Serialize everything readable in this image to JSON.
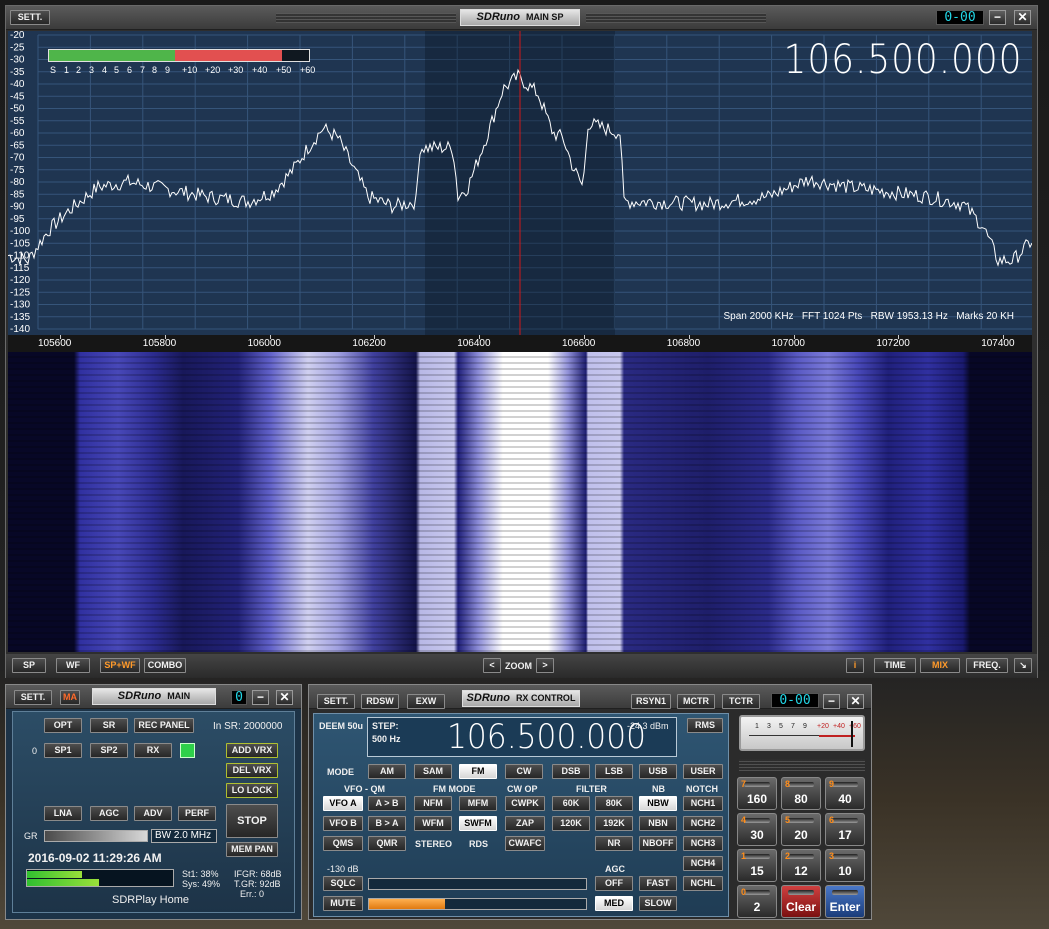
{
  "main_sp": {
    "sett_label": "SETT.",
    "logo_brand": "SDRuno",
    "logo_title": "MAIN SP",
    "led_counter": "0-00",
    "min_icon": "minimize-icon",
    "close_icon": "close-icon",
    "frequency": "106.500.000",
    "db_scale": [
      "-20",
      "-25",
      "-30",
      "-35",
      "-40",
      "-45",
      "-50",
      "-55",
      "-60",
      "-65",
      "-70",
      "-75",
      "-80",
      "-85",
      "-90",
      "-95",
      "-100",
      "-105",
      "-110",
      "-115",
      "-120",
      "-125",
      "-130",
      "-135",
      "-140"
    ],
    "smeter_scale": [
      "S",
      "1",
      "2",
      "3",
      "4",
      "5",
      "6",
      "7",
      "8",
      "9",
      "+10",
      "+20",
      "+30",
      "+40",
      "+50",
      "+60"
    ],
    "freq_axis": [
      "105600",
      "105800",
      "106000",
      "106200",
      "106400",
      "106600",
      "106800",
      "107000",
      "107200",
      "107400"
    ],
    "info_text": "Span 2000 KHz   FFT 1024 Pts   RBW 1953.13 Hz   Marks 20 KH",
    "bottom": {
      "sp": "SP",
      "wf": "WF",
      "spwf": "SP+WF",
      "combo": "COMBO",
      "zoom_left": "<",
      "zoom": "ZOOM",
      "zoom_right": ">",
      "info": "i",
      "time": "TIME",
      "mix": "MIX",
      "freq": "FREQ.",
      "resize_icon": "resize-icon"
    },
    "colors": {
      "grid_bg": "#1f3551",
      "trace": "#ffffff",
      "marker": "#d01818",
      "wf_mid": "#3a3aa8",
      "smeter_green": "#4fb54a",
      "smeter_red": "#e25050"
    }
  },
  "main": {
    "sett_label": "SETT.",
    "ma_label": "MA",
    "logo_brand": "SDRuno",
    "logo_title": "MAIN",
    "led_counter": "0",
    "buttons": {
      "opt": "OPT",
      "sr": "SR",
      "rec_panel": "REC PANEL",
      "sp1": "SP1",
      "sp2": "SP2",
      "rx": "RX",
      "add_vrx": "ADD VRX",
      "del_vrx": "DEL VRX",
      "lo_lock": "LO LOCK",
      "lna": "LNA",
      "agc": "AGC",
      "adv": "ADV",
      "perf": "PERF",
      "stop": "STOP",
      "mem_pan": "MEM PAN"
    },
    "in_sr": "In SR: 2000000",
    "vrx_index": "0",
    "gr_label": "GR",
    "bw_text": "BW 2.0 MHz",
    "datetime": "2016-09-02 11:29:26 AM",
    "st1": "St1: 38%",
    "sys": "Sys: 49%",
    "st1_level": 0.38,
    "sys_level": 0.49,
    "ifgr": "IFGR: 68dB",
    "tgr": "T.GR: 92dB",
    "err": "Err.: 0",
    "footer": "SDRPlay Home"
  },
  "rx_control": {
    "buttons_top": {
      "sett": "SETT.",
      "rdsw": "RDSW",
      "exw": "EXW",
      "rsyn1": "RSYN1",
      "mctr": "MCTR",
      "tctr": "TCTR"
    },
    "logo_brand": "SDRuno",
    "logo_title": "RX CONTROL",
    "led_counter": "0-00",
    "deem": "DEEM 50u",
    "step_label": "STEP:",
    "step_value": "500 Hz",
    "frequency": "106.500.000",
    "dbm": "-24.3 dBm",
    "rms": "RMS",
    "mode_label": "MODE",
    "modes": [
      "AM",
      "SAM",
      "FM",
      "CW",
      "DSB",
      "LSB",
      "USB"
    ],
    "user": "USER",
    "section_labels": {
      "vfo": "VFO - QM",
      "fm_mode": "FM MODE",
      "cw_op": "CW OP",
      "filter": "FILTER",
      "nb": "NB",
      "notch": "NOTCH"
    },
    "vfo": {
      "vfo_a": "VFO A",
      "a_to_b": "A > B",
      "vfo_b": "VFO B",
      "b_to_a": "B > A",
      "qms": "QMS",
      "qmr": "QMR"
    },
    "fm": {
      "nfm": "NFM",
      "mfm": "MFM",
      "wfm": "WFM",
      "swfm": "SWFM",
      "stereo": "STEREO",
      "rds": "RDS"
    },
    "cw": {
      "cwpk": "CWPK",
      "zap": "ZAP",
      "cwafc": "CWAFC"
    },
    "filter": {
      "f60k": "60K",
      "f80k": "80K",
      "f120k": "120K",
      "f192k": "192K",
      "nr": "NR"
    },
    "nb": {
      "nbw": "NBW",
      "nbn": "NBN",
      "nboff": "NBOFF"
    },
    "notch": [
      "NCH1",
      "NCH2",
      "NCH3",
      "NCH4",
      "NCHL"
    ],
    "squelch_db": "-130 dB",
    "sqlc": "SQLC",
    "mute": "MUTE",
    "agc_label": "AGC",
    "agc": {
      "off": "OFF",
      "fast": "FAST",
      "med": "MED",
      "slow": "SLOW"
    },
    "volume_level": 0.35,
    "meter_scale": [
      "1",
      "3",
      "5",
      "7",
      "9",
      "+20",
      "+40",
      "+60"
    ],
    "keypad": [
      {
        "n": "7",
        "v": "160"
      },
      {
        "n": "8",
        "v": "80"
      },
      {
        "n": "9",
        "v": "40"
      },
      {
        "n": "4",
        "v": "30"
      },
      {
        "n": "5",
        "v": "20"
      },
      {
        "n": "6",
        "v": "17"
      },
      {
        "n": "1",
        "v": "15"
      },
      {
        "n": "2",
        "v": "12"
      },
      {
        "n": "3",
        "v": "10"
      },
      {
        "n": "0",
        "v": "2"
      },
      {
        "n": "",
        "v": "Clear"
      },
      {
        "n": "",
        "v": "Enter"
      }
    ]
  }
}
